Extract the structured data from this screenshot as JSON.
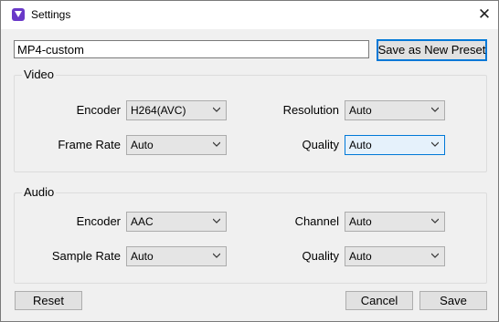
{
  "window": {
    "title": "Settings",
    "close_glyph": "✕"
  },
  "preset": {
    "name_value": "MP4-custom",
    "save_button": "Save as New Preset"
  },
  "video": {
    "group_title": "Video",
    "encoder_label": "Encoder",
    "encoder_value": "H264(AVC)",
    "resolution_label": "Resolution",
    "resolution_value": "Auto",
    "frame_rate_label": "Frame Rate",
    "frame_rate_value": "Auto",
    "quality_label": "Quality",
    "quality_value": "Auto"
  },
  "audio": {
    "group_title": "Audio",
    "encoder_label": "Encoder",
    "encoder_value": "AAC",
    "channel_label": "Channel",
    "channel_value": "Auto",
    "sample_rate_label": "Sample Rate",
    "sample_rate_value": "Auto",
    "quality_label": "Quality",
    "quality_value": "Auto"
  },
  "footer": {
    "reset_button": "Reset",
    "cancel_button": "Cancel",
    "save_button": "Save"
  },
  "colors": {
    "accent": "#0078d7",
    "app_icon": "#6a39c8"
  }
}
